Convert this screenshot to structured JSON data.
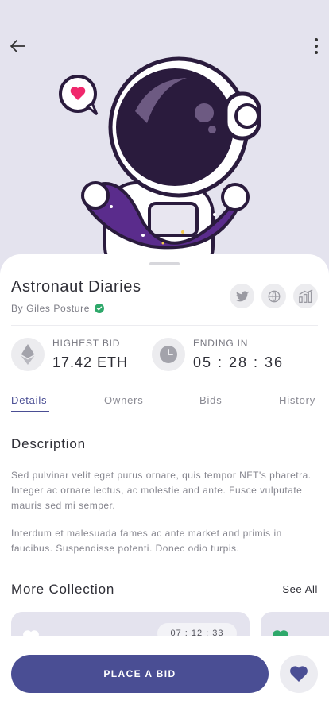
{
  "colors": {
    "accent": "#4a4e94",
    "hero_background": "#e4e3ee",
    "verified": "#2ea86a",
    "heart_pink": "#f0286c",
    "card_heart_green": "#2ea86a"
  },
  "header": {
    "back_icon": "arrow-left-icon",
    "menu_icon": "more-vertical-icon"
  },
  "nft": {
    "title": "Astronaut Diaries",
    "creator_line": "By Giles Posture",
    "verified_icon": "check-badge-icon",
    "socials": [
      "twitter-icon",
      "globe-icon",
      "stats-icon"
    ]
  },
  "stats": {
    "highest_bid_label": "HIGHEST BID",
    "highest_bid_value": "17.42 ETH",
    "highest_bid_icon": "ethereum-icon",
    "ending_label": "ENDING IN",
    "ending_value": "05 : 28 : 36",
    "ending_icon": "clock-icon"
  },
  "tabs": [
    {
      "label": "Details",
      "active": true
    },
    {
      "label": "Owners",
      "active": false
    },
    {
      "label": "Bids",
      "active": false
    },
    {
      "label": "History",
      "active": false
    }
  ],
  "description": {
    "title": "Description",
    "paragraph_1": "Sed pulvinar velit eget purus ornare, quis tempor NFT's pharetra. Integer ac ornare lectus, ac molestie and ante. Fusce vulputate mauris sed mi semper.",
    "paragraph_2": "Interdum et malesuada fames ac ante market and primis in faucibus. Suspendisse potenti. Donec odio turpis."
  },
  "collection": {
    "title": "More Collection",
    "see_all": "See All",
    "card_1_timer": "07 : 12 : 33"
  },
  "actions": {
    "place_bid": "PLACE A BID",
    "favorite_icon": "heart-icon"
  }
}
